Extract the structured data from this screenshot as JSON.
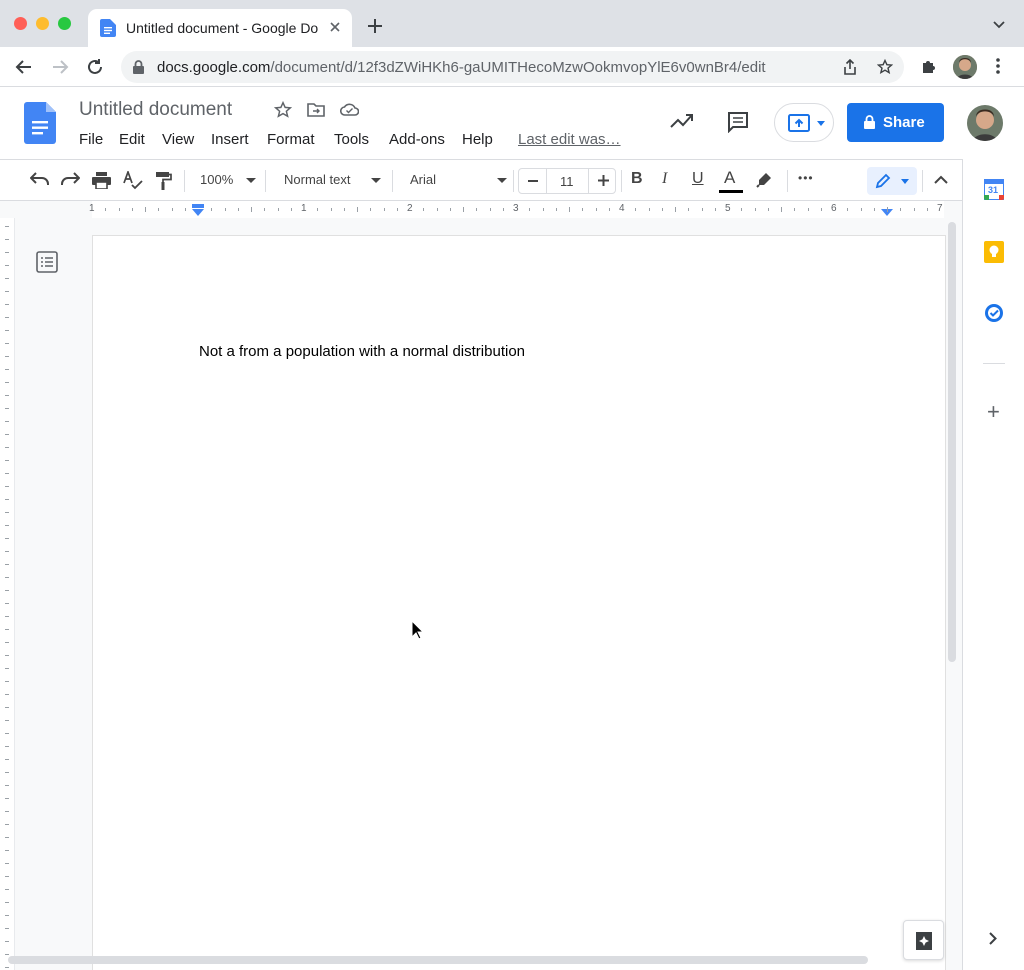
{
  "browser": {
    "tab_title": "Untitled document - Google Docs",
    "url_host": "docs.google.com",
    "url_path": "/document/d/12f3dZWiHKh6-gaUMITHecoMzwOokmvopYlE6v0wnBr4/edit",
    "colors": {
      "traffic_close": "#ff5f57",
      "traffic_min": "#febc2e",
      "traffic_max": "#28c840"
    }
  },
  "docs": {
    "title": "Untitled document",
    "menu": [
      "File",
      "Edit",
      "View",
      "Insert",
      "Format",
      "Tools",
      "Add-ons",
      "Help"
    ],
    "last_edit": "Last edit was…",
    "share_label": "Share",
    "accent": "#1a73e8"
  },
  "toolbar": {
    "zoom": "100%",
    "style": "Normal text",
    "font": "Arial",
    "font_size": "11",
    "bold": "B",
    "italic": "I",
    "underline": "U",
    "text_color": "A",
    "more": "•••"
  },
  "ruler": {
    "numbers": [
      "1",
      "1",
      "2",
      "3",
      "4",
      "5",
      "6",
      "7"
    ]
  },
  "document": {
    "body_text": "Not a from a population with a normal distribution"
  },
  "side_panel": {
    "calendar_day": "31",
    "plus": "+"
  }
}
